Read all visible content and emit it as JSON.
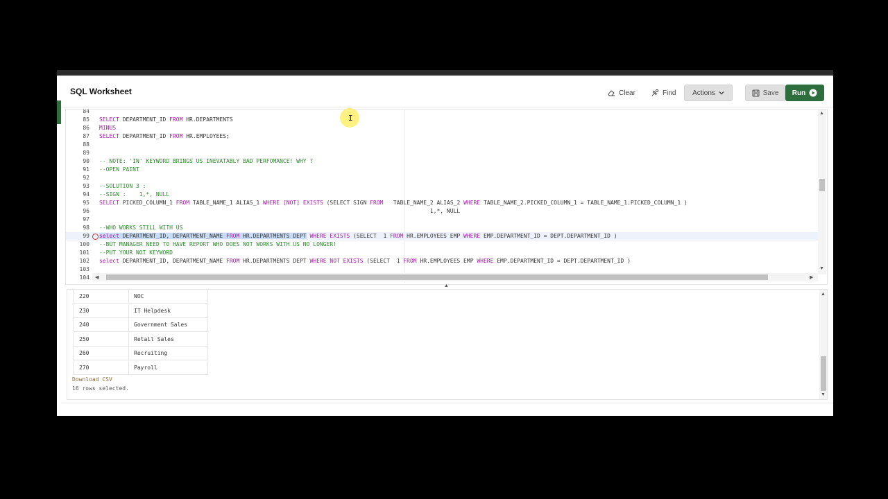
{
  "app": {
    "title": "SQL Worksheet"
  },
  "toolbar": {
    "clear_label": "Clear",
    "find_label": "Find",
    "actions_label": "Actions",
    "save_label": "Save",
    "run_label": "Run",
    "run_color": "#2e6e3e"
  },
  "editor": {
    "lines": [
      {
        "n": "84",
        "t": ""
      },
      {
        "n": "85",
        "t": "SELECT DEPARTMENT_ID FROM HR.DEPARTMENTS"
      },
      {
        "n": "86",
        "t": "MINUS"
      },
      {
        "n": "87",
        "t": "SELECT DEPARTMENT_ID FROM HR.EMPLOYEES;"
      },
      {
        "n": "88",
        "t": ""
      },
      {
        "n": "89",
        "t": ""
      },
      {
        "n": "90",
        "t": "-- NOTE: 'IN' KEYWORD BRINGS US INEVATABLY BAD PERFOMANCE! WHY ?"
      },
      {
        "n": "91",
        "t": "--OPEN PAINT"
      },
      {
        "n": "92",
        "t": ""
      },
      {
        "n": "93",
        "t": "--SOLUTION 3 :"
      },
      {
        "n": "94",
        "t": "--SIGN :    1,*, NULL"
      },
      {
        "n": "95",
        "t": "SELECT PICKED_COLUMN_1 FROM TABLE_NAME_1 ALIAS_1 WHERE [NOT] EXISTS (SELECT SIGN FROM   TABLE_NAME_2 ALIAS_2 WHERE TABLE_NAME_2.PICKED_COLUMN_1 = TABLE_NAME_1.PICKED_COLUMN_1 )"
      },
      {
        "n": "96",
        "t": "                                                                                                   1,*, NULL"
      },
      {
        "n": "97",
        "t": ""
      },
      {
        "n": "98",
        "t": "--WHO WORKS STILL WITH US"
      },
      {
        "n": "99",
        "t": "select DEPARTMENT_ID, DEPARTMENT_NAME FROM HR.DEPARTMENTS DEPT WHERE EXISTS (SELECT  1 FROM HR.EMPLOYEES EMP WHERE EMP.DEPARTMENT_ID = DEPT.DEPARTMENT_ID )"
      },
      {
        "n": "100",
        "t": "--BUT MANAGER NEED TO HAVE REPORT WHO DOES NOT WORKS WITH US NO LONGER!"
      },
      {
        "n": "101",
        "t": "--PUT YOUR NOT KEYWORD"
      },
      {
        "n": "102",
        "t": "select DEPARTMENT_ID, DEPARTMENT_NAME FROM HR.DEPARTMENTS DEPT WHERE NOT EXISTS (SELECT  1 FROM HR.EMPLOYEES EMP WHERE EMP.DEPARTMENT_ID = DEPT.DEPARTMENT_ID )"
      },
      {
        "n": "103",
        "t": ""
      },
      {
        "n": "104",
        "t": ""
      }
    ],
    "keywords": [
      "SELECT",
      "select",
      "FROM",
      "MINUS",
      "WHERE",
      "EXISTS",
      "NOT",
      "[NOT]"
    ],
    "active_line": "99",
    "selected_text": "select DEPARTMENT_ID, DEPARTMENT_NAME FROM HR.DEPARTMENTS DEPT"
  },
  "results": {
    "rows": [
      {
        "id": "220",
        "name": "NOC"
      },
      {
        "id": "230",
        "name": "IT Helpdesk"
      },
      {
        "id": "240",
        "name": "Government Sales"
      },
      {
        "id": "250",
        "name": "Retail Sales"
      },
      {
        "id": "260",
        "name": "Recruiting"
      },
      {
        "id": "270",
        "name": "Payroll"
      }
    ],
    "download_label": "Download CSV",
    "summary": "16 rows selected."
  }
}
